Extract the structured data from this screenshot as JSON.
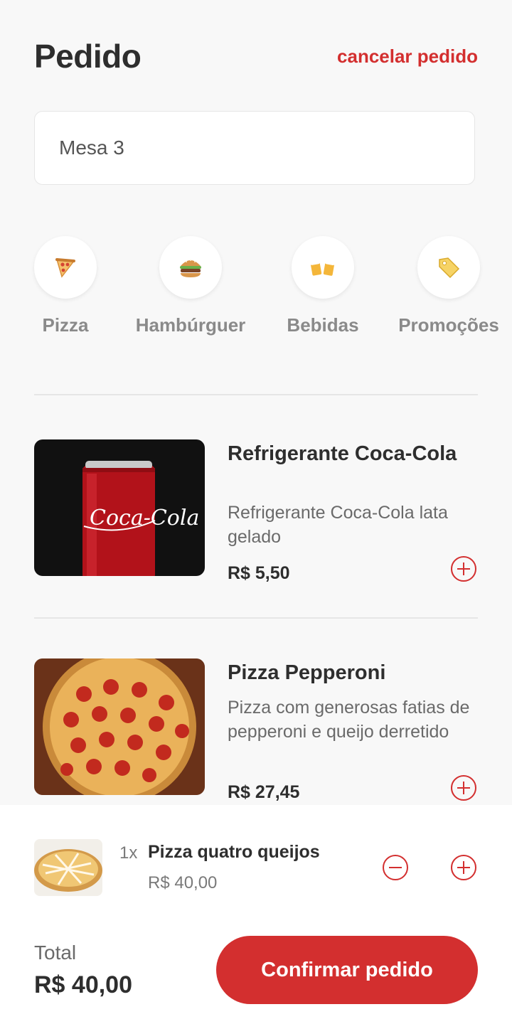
{
  "header": {
    "title": "Pedido",
    "cancel_label": "cancelar pedido"
  },
  "table_field": {
    "value": "Mesa 3"
  },
  "categories": [
    {
      "label": "Pizza",
      "icon": "pizza-icon"
    },
    {
      "label": "Hambúrguer",
      "icon": "hamburger-icon"
    },
    {
      "label": "Bebidas",
      "icon": "beer-mugs-icon"
    },
    {
      "label": "Promoções",
      "icon": "price-tag-icon"
    }
  ],
  "products": [
    {
      "name": "Refrigerante Coca-Cola",
      "description": "Refrigerante Coca-Cola lata gelado",
      "price": "R$ 5,50",
      "image_text": "Coca-Cola"
    },
    {
      "name": "Pizza Pepperoni",
      "description": "Pizza com generosas fatias de pepperoni e queijo derretido",
      "price": "R$ 27,45"
    }
  ],
  "cart": {
    "items": [
      {
        "quantity": "1x",
        "name": "Pizza quatro queijos",
        "price": "R$ 40,00"
      }
    ],
    "total_label": "Total",
    "total_value": "R$ 40,00",
    "confirm_label": "Confirmar pedido"
  },
  "colors": {
    "accent": "#d32f2f",
    "background": "#f8f8f8",
    "muted_text": "#8a8a8a"
  }
}
